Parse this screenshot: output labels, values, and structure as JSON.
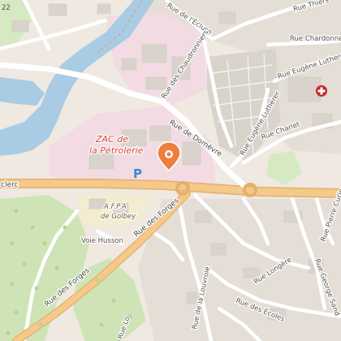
{
  "map": {
    "zones": {
      "zac_line1": "ZAC de",
      "zac_line2": "la Pétrolerie",
      "afpa_line1": "A.F.P.A",
      "afpa_line2": "de Golbey"
    },
    "corner_number": "22",
    "streets": {
      "ecluse": "Rue de l'Écluse",
      "thiers": "Rue Thiers",
      "chardonneret": "Rue Chardonne",
      "eugene_lutherer": "Rue Eugène Luthere",
      "chaudronniers": "Rue des Chaudronniers",
      "domevre": "Rue de Domèvre",
      "eugene_lutherer_vert": "Rue Eugène Lutherer",
      "charlet": "Rue Charlet",
      "leclerc": "clerc",
      "forges_upper": "Rue des Forges",
      "forges_lower": "Rue des Forges",
      "voie_husson": "Voie Husson",
      "longere": "Rue Longère",
      "pierre_curie": "Rue Pierre Curie",
      "george_sand": "Rue George Sand",
      "louvrois": "Rue de la Louvroie",
      "ecoles": "Rue des Écoles",
      "lou_fragment": "Rue Lo"
    },
    "pois": {
      "parking_letter": "P",
      "marker_icon": "map-pin-icon",
      "hospital_icon": "hospital-cross-icon"
    },
    "colors": {
      "water": "#a9cbe4",
      "wood": "#cfe4b6",
      "road_major": "#f4c98a",
      "road_minor": "#ffffff",
      "industrial": "#f2dbe2",
      "residential": "#e4ded6",
      "marker": "#ef7d3f",
      "zone_label": "#d2453a",
      "parking": "#3a8ad6",
      "hospital": "#c42a2a"
    }
  }
}
